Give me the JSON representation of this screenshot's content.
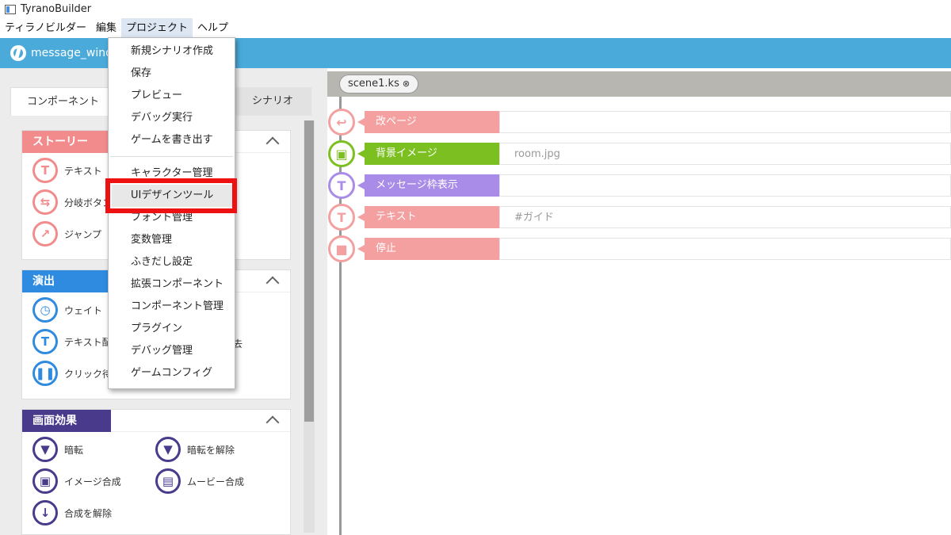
{
  "window": {
    "title": "TyranoBuilder"
  },
  "menubar": [
    "ティラノビルダー",
    "編集",
    "プロジェクト",
    "ヘルプ"
  ],
  "toolbar": {
    "project_name": "message_windo"
  },
  "left_tabs": {
    "components": "コンポーネント",
    "scenario": "シナリオ"
  },
  "panels": {
    "story": {
      "title": "ストーリー",
      "color": "#f28c8c",
      "items": [
        "テキスト",
        "分岐ボタン",
        "ジャンプ"
      ]
    },
    "effect": {
      "title": "演出",
      "color": "#2e8be0",
      "items": [
        "ウェイト",
        "テキスト配",
        "クリック待",
        "去"
      ]
    },
    "screen": {
      "title": "画面効果",
      "color": "#4a3a8c",
      "items": [
        "暗転",
        "暗転を解除",
        "イメージ合成",
        "ムービー合成",
        "合成を解除"
      ]
    }
  },
  "project_menu": {
    "items": [
      "新規シナリオ作成",
      "保存",
      "プレビュー",
      "デバッグ実行",
      "ゲームを書き出す",
      "キャラクター管理",
      "UIデザインツール",
      "フォント管理",
      "変数管理",
      "ふきだし設定",
      "拡張コンポーネント",
      "コンポーネント管理",
      "プラグイン",
      "デバッグ管理",
      "ゲームコンフィグ"
    ],
    "highlighted": "UIデザインツール"
  },
  "file_tab": {
    "name": "scene1.ks",
    "close_icon": "⊗"
  },
  "scenario_rows": [
    {
      "label": "改ページ",
      "value": "",
      "color": "#f4a0a0",
      "icon": "return-arrow-icon"
    },
    {
      "label": "背景イメージ",
      "value": "room.jpg",
      "color": "#7cbf20",
      "icon": "background-image-icon"
    },
    {
      "label": "メッセージ枠表示",
      "value": "",
      "color": "#a98ce8",
      "icon": "message-window-icon"
    },
    {
      "label": "テキスト",
      "value": "#ガイド",
      "color": "#f4a0a0",
      "icon": "text-T-icon"
    },
    {
      "label": "停止",
      "value": "",
      "color": "#f4a0a0",
      "icon": "stop-icon"
    }
  ]
}
